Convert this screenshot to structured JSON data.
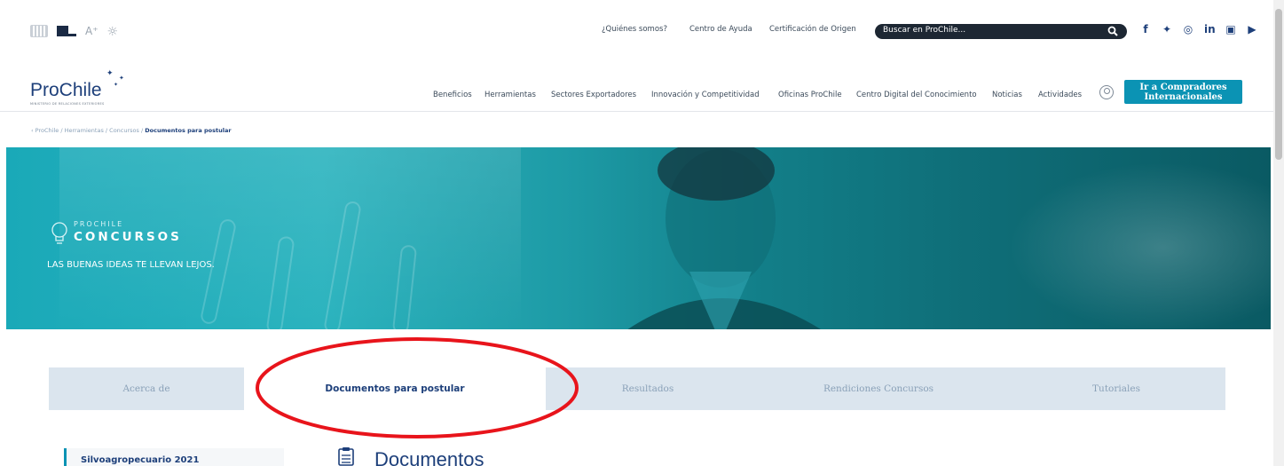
{
  "top_links": [
    "¿Quiénes somos?",
    "Centro de Ayuda",
    "Certificación de Origen"
  ],
  "search": {
    "placeholder": "Buscar en ProChile..."
  },
  "social_icons": [
    "facebook-icon",
    "twitter-icon",
    "instagram-icon",
    "linkedin-icon",
    "flickr-icon",
    "youtube-icon"
  ],
  "logo": {
    "word": "ProChile",
    "sub": "MINISTERIO DE RELACIONES EXTERIORES"
  },
  "nav": {
    "items": [
      "Beneficios",
      "Herramientas",
      "Sectores Exportadores",
      "Innovación y Competitividad",
      "Oficinas ProChile",
      "Centro Digital del Conocimiento",
      "Noticias",
      "Actividades"
    ],
    "cta_line1": "Ir a Compradores",
    "cta_line2": "Internacionales"
  },
  "breadcrumb": {
    "path": "‹ ProChile / Herramientas / Concursos /",
    "current": "Documentos para postular"
  },
  "hero": {
    "brand_small": "PROCHILE",
    "brand_big": "CONCURSOS",
    "tagline": "LAS BUENAS IDEAS TE LLEVAN LEJOS."
  },
  "tabs": [
    {
      "label": "Acerca de",
      "active": false
    },
    {
      "label": "Documentos para postular",
      "active": true
    },
    {
      "label": "Resultados",
      "active": false
    },
    {
      "label": "Rendiciones Concursos",
      "active": false
    },
    {
      "label": "Tutoriales",
      "active": false
    }
  ],
  "sidebar": {
    "items": [
      {
        "label": "Silvoagropecuario 2021"
      }
    ]
  },
  "main": {
    "heading": "Documentos"
  },
  "colors": {
    "navy": "#1d3f7a",
    "teal": "#0b93b4",
    "annotation": "#e8141b"
  }
}
